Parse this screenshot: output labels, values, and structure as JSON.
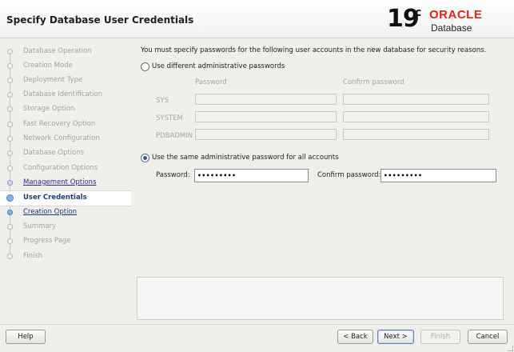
{
  "header": {
    "title": "Specify Database User Credentials",
    "brand_version": "19",
    "brand_sup": "c",
    "brand_name": "ORACLE",
    "brand_product": "Database"
  },
  "steps": [
    {
      "label": "Database Operation",
      "state": "pending"
    },
    {
      "label": "Creation Mode",
      "state": "pending"
    },
    {
      "label": "Deployment Type",
      "state": "pending"
    },
    {
      "label": "Database Identification",
      "state": "pending"
    },
    {
      "label": "Storage Option",
      "state": "pending"
    },
    {
      "label": "Fast Recovery Option",
      "state": "pending"
    },
    {
      "label": "Network Configuration",
      "state": "pending"
    },
    {
      "label": "Database Options",
      "state": "pending"
    },
    {
      "label": "Configuration Options",
      "state": "pending"
    },
    {
      "label": "Management Options",
      "state": "visited"
    },
    {
      "label": "User Credentials",
      "state": "current"
    },
    {
      "label": "Creation Option",
      "state": "next"
    },
    {
      "label": "Summary",
      "state": "pending"
    },
    {
      "label": "Progress Page",
      "state": "pending"
    },
    {
      "label": "Finish",
      "state": "pending"
    }
  ],
  "main": {
    "intro": "You must specify passwords for the following user accounts in the new database for security reasons.",
    "option_different": "Use different administrative passwords",
    "col_password": "Password",
    "col_confirm": "Confirm password",
    "rows": [
      {
        "label": "SYS"
      },
      {
        "label": "SYSTEM"
      },
      {
        "label": "PDBADMIN"
      }
    ],
    "option_same": "Use the same administrative password for all accounts",
    "same_password_label": "Password:",
    "same_password_value": "•••••••••",
    "same_confirm_label": "Confirm password:",
    "same_confirm_value": "•••••••••"
  },
  "buttons": {
    "help": "Help",
    "back": "< Back",
    "next": "Next >",
    "finish": "Finish",
    "cancel": "Cancel"
  },
  "colors": {
    "oracle_red": "#e2231a",
    "current_step": "#1b3d73",
    "visited_step": "#3a1f8c"
  }
}
